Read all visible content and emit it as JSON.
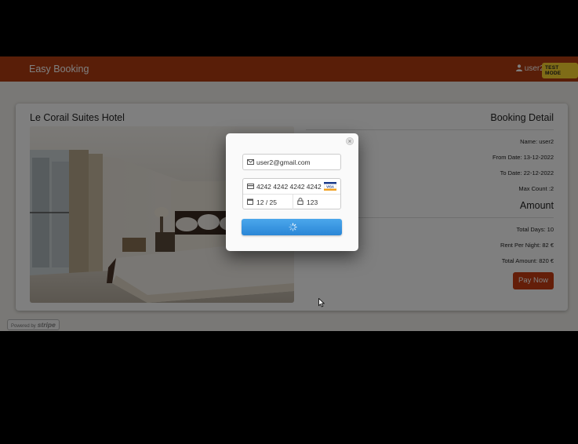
{
  "navbar": {
    "brand": "Easy Booking",
    "user": "user2",
    "test_mode_badge": "TEST MODE"
  },
  "hotel": {
    "name": "Le Corail Suites Hotel"
  },
  "booking_detail": {
    "title": "Booking Detail",
    "name": "Name: user2",
    "from_date": "From Date: 13-12-2022",
    "to_date": "To Date: 22-12-2022",
    "max_count": "Max Count :2"
  },
  "amount": {
    "title": "Amount",
    "total_days": "Total Days: 10",
    "rent_per_night": "Rent Per Night: 82 €",
    "total_amount": "Total Amount: 820 €",
    "pay_button": "Pay Now"
  },
  "stripe_badge": {
    "powered_by": "Powered by",
    "brand": "stripe"
  },
  "checkout": {
    "email": "user2@gmail.com",
    "card_number": "4242 4242 4242 4242",
    "expiry": "12 / 25",
    "cvc": "123",
    "card_brand": "VISA",
    "icons": [
      "envelope-icon",
      "credit-card-icon",
      "calendar-icon",
      "lock-icon",
      "visa-card-icon",
      "loading-spinner-icon",
      "close-icon"
    ]
  },
  "colors": {
    "navbar": "#b33c10",
    "accent_button": "#c83d12",
    "test_mode_badge": "#ffd92e",
    "stripe_button": "#2a86d6"
  }
}
